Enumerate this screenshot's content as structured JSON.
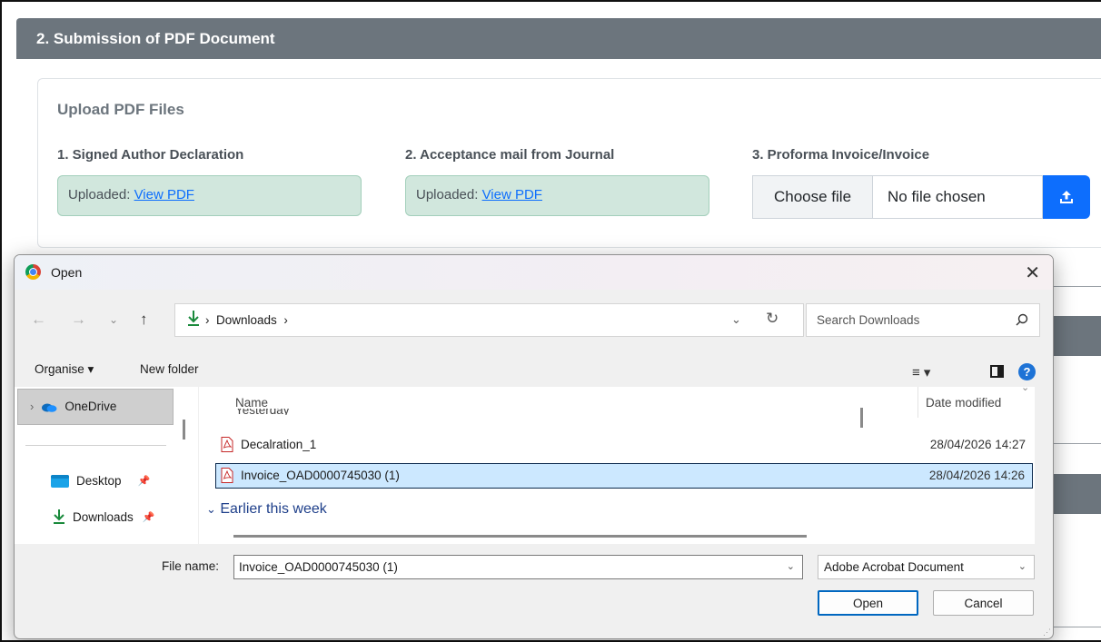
{
  "page": {
    "section_title": "2. Submission of PDF Document",
    "upload_title": "Upload PDF Files",
    "documents": [
      {
        "label": "1. Signed Author Declaration",
        "status": "Uploaded: ",
        "link": "View PDF"
      },
      {
        "label": "2. Acceptance mail from Journal",
        "status": "Uploaded: ",
        "link": "View PDF"
      },
      {
        "label": "3. Proforma Invoice/Invoice",
        "choose_label": "Choose file",
        "no_file_label": "No file chosen"
      }
    ],
    "colors": {
      "header": "#6c757d",
      "uploaded_bg": "#d1e7dd",
      "link": "#0d6efd",
      "upload_btn": "#0d6efd"
    }
  },
  "dialog": {
    "title": "Open",
    "close": "✕",
    "address": {
      "folder": "Downloads",
      "separator": "›"
    },
    "search_placeholder": "Search Downloads",
    "toolbar": {
      "organise": "Organise ▾",
      "new_folder": "New folder"
    },
    "nav": {
      "onedrive": "OneDrive",
      "desktop": "Desktop",
      "downloads": "Downloads"
    },
    "columns": {
      "name": "Name",
      "date": "Date modified"
    },
    "partial_group": "Yesterday",
    "files": [
      {
        "name": "Decalration_1",
        "date": "28/04/2026 14:27",
        "selected": false
      },
      {
        "name": "Invoice_OAD0000745030 (1)",
        "date": "28/04/2026 14:26",
        "selected": true
      }
    ],
    "group_earlier": "Earlier this week",
    "footer": {
      "file_name_label": "File name:",
      "file_name_value": "Invoice_OAD0000745030 (1)",
      "file_type": "Adobe Acrobat Document",
      "open": "Open",
      "cancel": "Cancel"
    }
  }
}
